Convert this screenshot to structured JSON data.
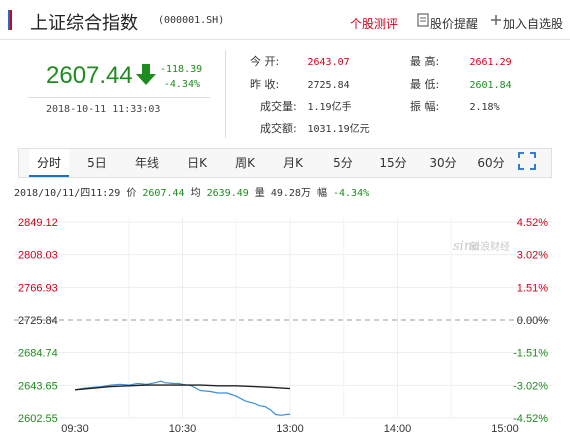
{
  "header": {
    "title": "上证综合指数",
    "code": "(000001.SH)",
    "links": [
      "个股测评",
      "股价提醒",
      "加入自选股"
    ]
  },
  "quote": {
    "price": "2607.44",
    "change": "-118.39",
    "change_pct": "-4.34%",
    "datetime": "2018-10-11  11:33:03",
    "stats": [
      {
        "label": "今    开:",
        "value": "2643.07",
        "color": "red"
      },
      {
        "label": "昨    收:",
        "value": "2725.84",
        "color": "normal"
      },
      {
        "label": "成交量:",
        "value": "1.19亿手",
        "color": "normal"
      },
      {
        "label": "成交额:",
        "value": "1031.19亿元",
        "color": "normal"
      },
      {
        "label": "最    高:",
        "value": "2661.29",
        "color": "red"
      },
      {
        "label": "最    低:",
        "value": "2601.84",
        "color": "green"
      },
      {
        "label": "振    幅:",
        "value": "2.18%",
        "color": "normal"
      }
    ]
  },
  "tabs": [
    "分时",
    "5日",
    "年线",
    "日K",
    "周K",
    "月K",
    "5分",
    "15分",
    "30分",
    "60分"
  ],
  "active_tab": "分时",
  "info_line": {
    "datetime": "2018/10/11/四11:29",
    "price_label": "价",
    "price": "2607.44",
    "avg_label": "均",
    "avg": "2639.49",
    "vol_label": "量",
    "vol": "49.28万",
    "pct_label": "幅",
    "pct": "-4.34%"
  },
  "watermark": "新浪财经",
  "colors": {
    "up": "#d0021b",
    "down": "#1e8c1e",
    "accent": "#1e6fc7",
    "price_line": "#3a8fd8",
    "avg_line": "#222222"
  },
  "chart_data": {
    "type": "line",
    "y_left_ticks": [
      "2849.12",
      "2808.03",
      "2766.93",
      "2725.84",
      "2684.74",
      "2643.65",
      "2602.55"
    ],
    "y_right_ticks": [
      "4.52%",
      "3.02%",
      "1.51%",
      "0.00%",
      "-1.51%",
      "-3.02%",
      "-4.52%"
    ],
    "x_ticks": [
      "09:30",
      "10:30",
      "13:00",
      "14:00",
      "15:00"
    ],
    "ylim": [
      2602.55,
      2849.12
    ],
    "xlim": [
      0,
      240
    ],
    "series": [
      {
        "name": "价",
        "color": "#3a8fd8",
        "points": [
          [
            0,
            2638
          ],
          [
            5,
            2640
          ],
          [
            10,
            2641
          ],
          [
            15,
            2642
          ],
          [
            20,
            2644
          ],
          [
            25,
            2645
          ],
          [
            30,
            2644
          ],
          [
            35,
            2646
          ],
          [
            40,
            2645
          ],
          [
            45,
            2647
          ],
          [
            48,
            2649
          ],
          [
            50,
            2647
          ],
          [
            55,
            2646
          ],
          [
            58,
            2646
          ],
          [
            60,
            2645
          ],
          [
            65,
            2643
          ],
          [
            70,
            2637
          ],
          [
            75,
            2636
          ],
          [
            80,
            2634
          ],
          [
            85,
            2634
          ],
          [
            90,
            2630
          ],
          [
            95,
            2624
          ],
          [
            100,
            2621
          ],
          [
            103,
            2618
          ],
          [
            106,
            2617
          ],
          [
            109,
            2613
          ],
          [
            112,
            2607
          ],
          [
            115,
            2606
          ],
          [
            118,
            2607
          ],
          [
            120,
            2607.44
          ]
        ]
      },
      {
        "name": "均",
        "color": "#222222",
        "points": [
          [
            0,
            2638
          ],
          [
            10,
            2640
          ],
          [
            20,
            2642
          ],
          [
            30,
            2643
          ],
          [
            40,
            2644
          ],
          [
            50,
            2644
          ],
          [
            60,
            2644
          ],
          [
            70,
            2644
          ],
          [
            80,
            2643
          ],
          [
            90,
            2643
          ],
          [
            100,
            2642
          ],
          [
            110,
            2641
          ],
          [
            120,
            2639.49
          ]
        ]
      }
    ]
  }
}
